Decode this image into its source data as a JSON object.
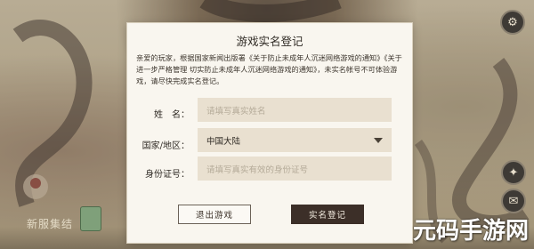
{
  "dialog": {
    "title": "游戏实名登记",
    "notice": "亲爱的玩家，根据国家新闻出版署《关于防止未成年人沉迷网络游戏的通知》《关于进一步严格管理 切实防止未成年人沉迷网络游戏的通知》，未实名帐号不可体验游戏，请尽快完成实名登记。",
    "name": {
      "label": "姓　名：",
      "placeholder": "请填写真实姓名"
    },
    "region": {
      "label": "国家/地区：",
      "value": "中国大陆"
    },
    "id_number": {
      "label": "身份证号：",
      "placeholder": "请填写真实有效的身份证号"
    },
    "exit_button": "退出游戏",
    "submit_button": "实名登记"
  },
  "background": {
    "bottom_label": "新服集结",
    "top_right_icon": "gear-icon",
    "right_icons": [
      "gift-icon",
      "chat-icon",
      "mail-icon"
    ]
  },
  "watermark": "元码手游网"
}
